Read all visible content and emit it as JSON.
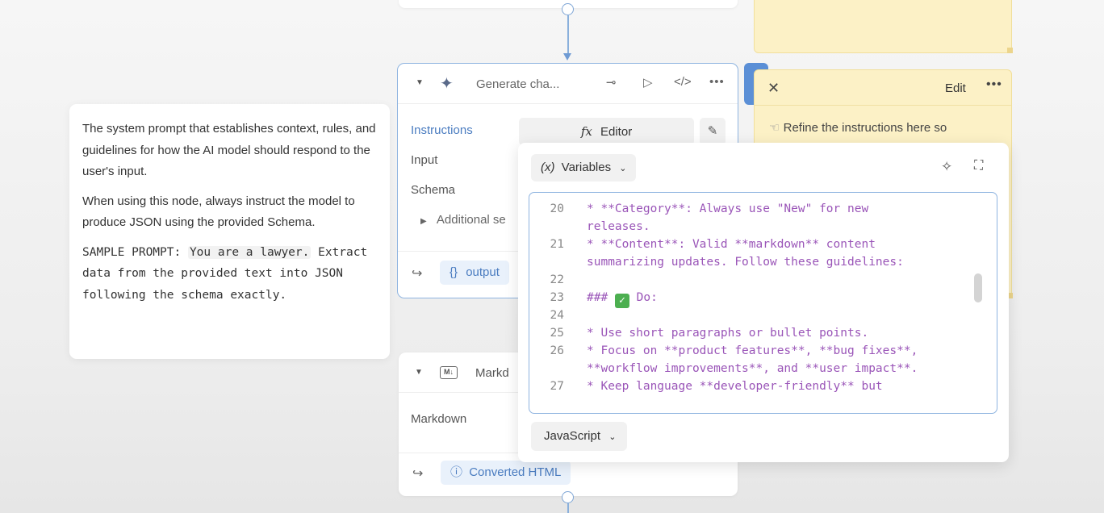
{
  "tooltip": {
    "para1": "The system prompt that establishes context, rules, and guidelines for how the AI model should respond to the user's input.",
    "para2": "When using this node, always instruct the model to produce JSON using the provided Schema.",
    "para3_prefix": "SAMPLE PROMPT: ",
    "para3_code": "You are a lawyer.",
    "para3_rest": "Extract data from the provided text into JSON following the schema exactly."
  },
  "gen_node": {
    "title": "Generate cha...",
    "props": [
      "Instructions",
      "Input",
      "Schema"
    ],
    "additional": "Additional se",
    "editor_label": "Editor",
    "editor_icon": "fx",
    "output": "output"
  },
  "md_node": {
    "title": "Markd",
    "badge": "M↓",
    "prop": "Markdown",
    "output": "Converted HTML"
  },
  "sticky": {
    "edit": "Edit",
    "text": "Refine the instructions here so"
  },
  "editor_popup": {
    "variables": "Variables",
    "variables_icon": "(x)",
    "language": "JavaScript",
    "lines": [
      {
        "n": "20",
        "t": "* **Category**: Always use \"New\" for new"
      },
      {
        "n": "",
        "t": "releases."
      },
      {
        "n": "21",
        "t": "* **Content**: Valid **markdown** content"
      },
      {
        "n": "",
        "t": "summarizing updates. Follow these guidelines:"
      },
      {
        "n": "22",
        "t": ""
      },
      {
        "n": "23",
        "t": "### ",
        "check": "✓",
        "t2": " Do:"
      },
      {
        "n": "24",
        "t": ""
      },
      {
        "n": "25",
        "t": "* Use short paragraphs or bullet points."
      },
      {
        "n": "26",
        "t": "* Focus on **product features**, **bug fixes**,"
      },
      {
        "n": "",
        "t": "**workflow improvements**, and **user impact**."
      },
      {
        "n": "27",
        "t": "* Keep language **developer-friendly** but"
      }
    ]
  }
}
